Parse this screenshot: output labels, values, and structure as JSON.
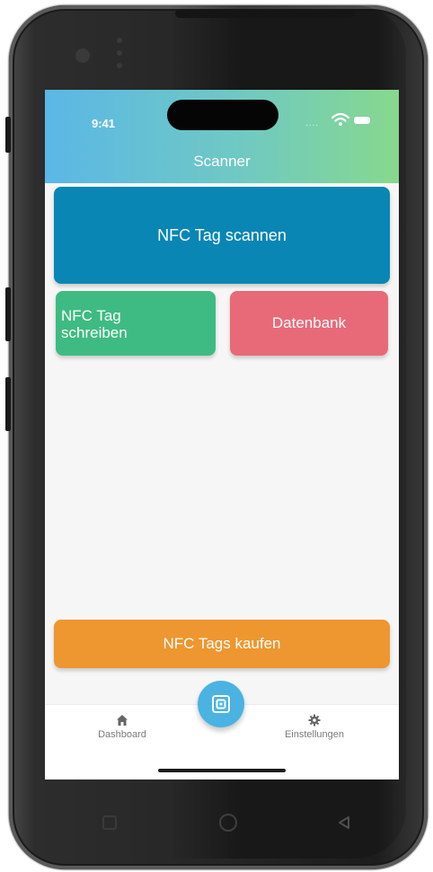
{
  "status_bar": {
    "time": "9:41",
    "signal": "....",
    "icons": [
      "wifi-icon",
      "battery-icon"
    ]
  },
  "header": {
    "title": "Scanner"
  },
  "actions": {
    "scan_label": "NFC Tag scannen",
    "write_label_line1": "NFC Tag",
    "write_label_line2": "schreiben",
    "database_label": "Datenbank",
    "buy_label": "NFC Tags kaufen"
  },
  "bottom_nav": {
    "dashboard_label": "Dashboard",
    "settings_label": "Einstellungen",
    "center_icon": "nfc-scan-icon"
  },
  "device_nav": {
    "icons": [
      "recents-icon",
      "home-icon",
      "back-icon"
    ]
  },
  "colors": {
    "header_gradient": [
      "#5bb7e6",
      "#87d88d"
    ],
    "scan": "#0986b4",
    "write": "#3ebb82",
    "database": "#e86a78",
    "buy": "#ee962f",
    "fab": "#4ab3e2"
  }
}
